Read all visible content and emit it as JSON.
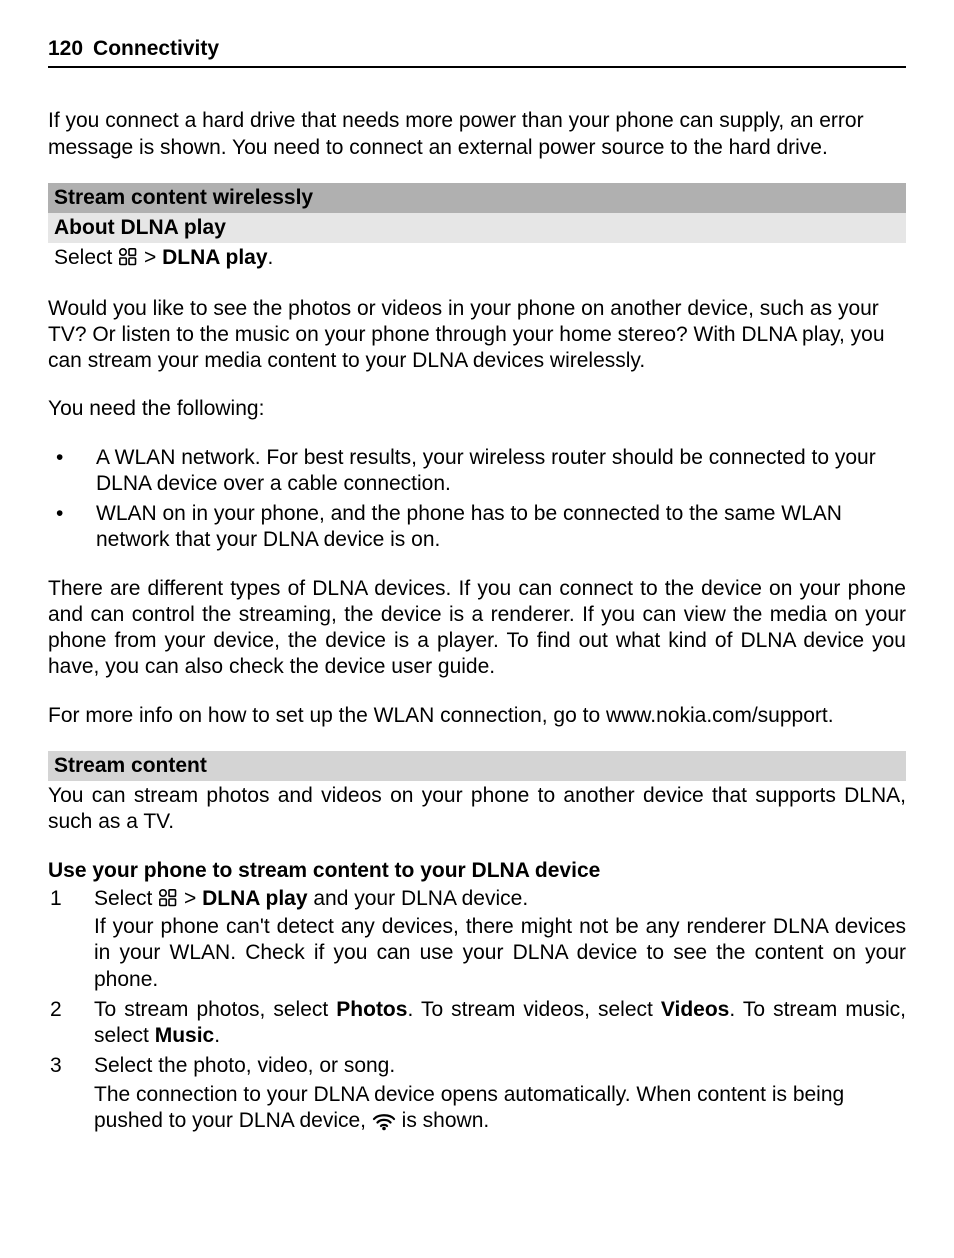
{
  "header": {
    "pageNum": "120",
    "title": "Connectivity"
  },
  "intro": "If you connect a hard drive that needs more power than your phone can supply, an error message is shown. You need to connect an external power source to the hard drive.",
  "sectionStreamWirelessly": "Stream content wirelessly",
  "sectionAboutDlna": "About DLNA play",
  "selectPrefix": "Select ",
  "gt": " > ",
  "dlnaPlay": "DLNA play",
  "period": ".",
  "paraIntro": "Would you like to see the photos or videos in your phone on another device, such as your TV? Or listen to the music on your phone through your home stereo? With DLNA play, you can stream your media content to your DLNA devices wirelessly.",
  "needFollowing": "You need the following:",
  "bullet1": "A WLAN network. For best results, your wireless router should be connected to your DLNA device over a cable connection.",
  "bullet2": "WLAN on in your phone, and the phone has to be connected to the same WLAN network that your DLNA device is on.",
  "deviceTypes": "There are different types of DLNA devices. If you can connect to the device on your phone and can control the streaming, the device is a renderer. If you can view the media on your phone from your device, the device is a player. To find out what kind of DLNA device you have, you can also check the device user guide.",
  "moreInfo": "For more info on how to set up the WLAN connection, go to www.nokia.com/support.",
  "sectionStreamContent": "Stream content",
  "streamContentIntro": "You can stream photos and videos on your phone to another device that supports DLNA, such as a TV.",
  "usePhoneHeading": "Use your phone to stream content to your DLNA device",
  "steps": {
    "n1": "1",
    "s1a": "Select ",
    "s1b": " and your DLNA device.",
    "s1note": "If your phone can't detect any devices, there might not be any renderer DLNA devices in your WLAN. Check if you can use your DLNA device to see the content on your phone.",
    "n2": "2",
    "s2a": "To stream photos, select ",
    "s2b": "Photos",
    "s2c": ". To stream videos, select ",
    "s2d": "Videos",
    "s2e": ". To stream music, select ",
    "s2f": "Music",
    "n3": "3",
    "s3a": "Select the photo, video, or song.",
    "s3b1": "The connection to your DLNA device opens automatically. When content is being pushed to your DLNA device, ",
    "s3b2": " is shown."
  }
}
